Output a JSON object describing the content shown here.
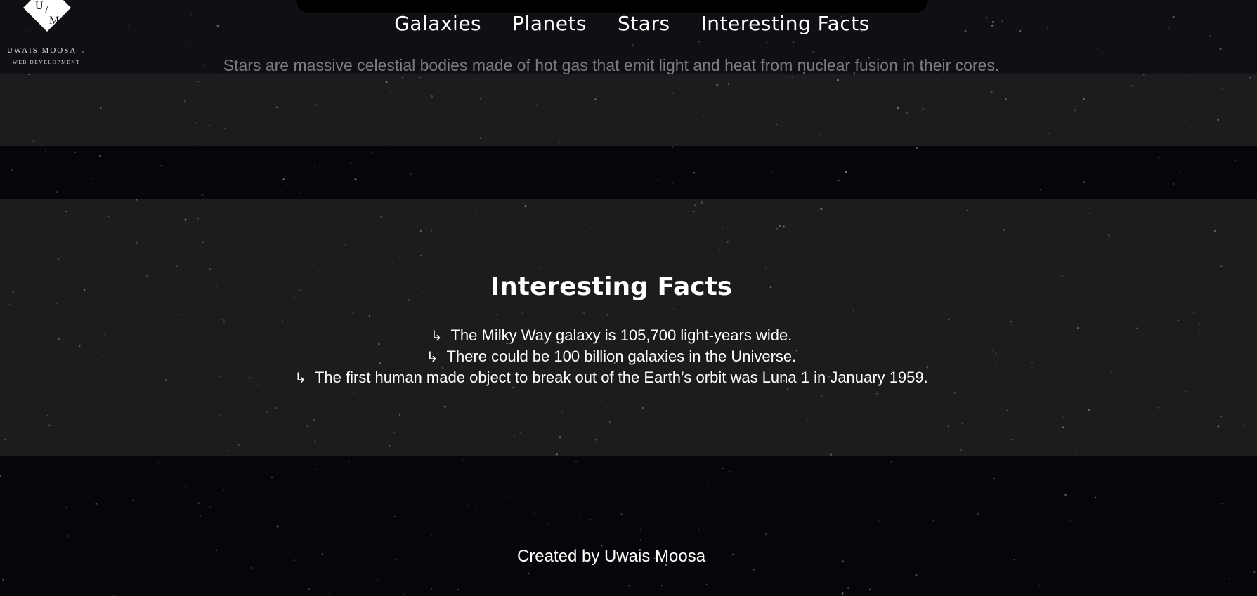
{
  "logo": {
    "initial_top": "U",
    "slash": "/",
    "initial_bottom": "M",
    "name": "UWAIS MOOSA",
    "subtitle": "WEB DEVELOPMENT"
  },
  "nav": {
    "items": [
      {
        "label": "Galaxies"
      },
      {
        "label": "Planets"
      },
      {
        "label": "Stars"
      },
      {
        "label": "Interesting Facts"
      }
    ]
  },
  "stars_section": {
    "description": "Stars are massive celestial bodies made of hot gas that emit light and heat from nuclear fusion in their cores."
  },
  "facts_section": {
    "title": "Interesting Facts",
    "bullet_icon": "↳",
    "items": [
      {
        "text": "The Milky Way galaxy is 105,700 light-years wide."
      },
      {
        "text": "There could be 100 billion galaxies in the Universe."
      },
      {
        "text": "The first human made object to break out of the Earth’s orbit was Luna 1 in January 1959."
      }
    ]
  },
  "footer": {
    "credit": "Created by Uwais Moosa"
  },
  "colors": {
    "background": "#06070a",
    "panel": "#1c1c1e",
    "header": "#0f1013",
    "muted_text": "#7c7c7e",
    "text": "#ffffff"
  }
}
